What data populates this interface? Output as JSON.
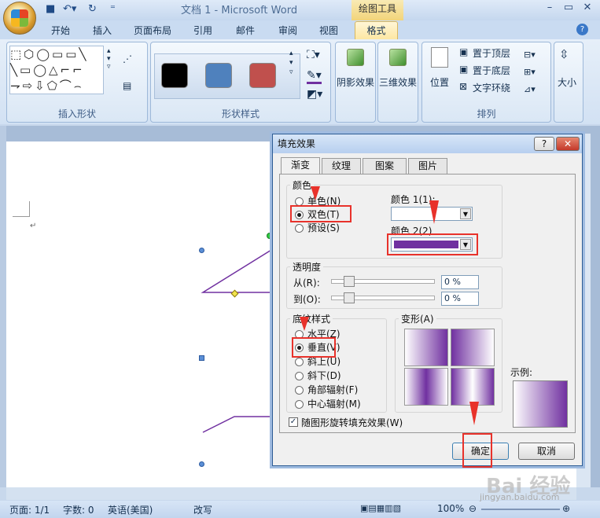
{
  "window": {
    "title": "文档 1 - Microsoft Word",
    "context_tab": "绘图工具",
    "controls": [
      "–",
      "▭",
      "✕"
    ]
  },
  "tabs": [
    "开始",
    "插入",
    "页面布局",
    "引用",
    "邮件",
    "审阅",
    "视图",
    "格式"
  ],
  "ribbon": {
    "groups": {
      "insert_shapes": "插入形状",
      "shape_styles": "形状样式",
      "arrange": "排列"
    },
    "shadow_effect": "阴影效果",
    "threed_effect": "三维效果",
    "position": "位置",
    "bring_to_front": "置于顶层",
    "send_to_back": "置于底层",
    "text_wrap": "文字环绕",
    "size": "大小",
    "swatch_colors": [
      "#000000",
      "#4f81bd",
      "#c0504d"
    ]
  },
  "dialog": {
    "title": "填充效果",
    "help": "?",
    "close": "✕",
    "tabs": [
      "渐变",
      "纹理",
      "图案",
      "图片"
    ],
    "colors": {
      "legend": "颜色",
      "options": [
        "单色(N)",
        "双色(T)",
        "预设(S)"
      ],
      "color1_label": "颜色 1(1):",
      "color2_label": "颜色 2(2)",
      "color2_value": "#7030a0"
    },
    "transparency": {
      "legend": "透明度",
      "from_label": "从(R):",
      "to_label": "到(O):",
      "from_value": "0 %",
      "to_value": "0 %"
    },
    "shading": {
      "legend": "底纹样式",
      "options": [
        "水平(Z)",
        "垂直(V)",
        "斜上(U)",
        "斜下(D)",
        "角部辐射(F)",
        "中心辐射(M)"
      ]
    },
    "variants_label": "变形(A)",
    "sample_label": "示例:",
    "rotate_checkbox": "随图形旋转填充效果(W)",
    "ok": "确定",
    "cancel": "取消"
  },
  "status": {
    "page": "页面: 1/1",
    "words": "字数: 0",
    "lang": "英语(美国)",
    "mode": "改写",
    "zoom": "100%"
  },
  "watermark": "jingyan.baidu.com"
}
